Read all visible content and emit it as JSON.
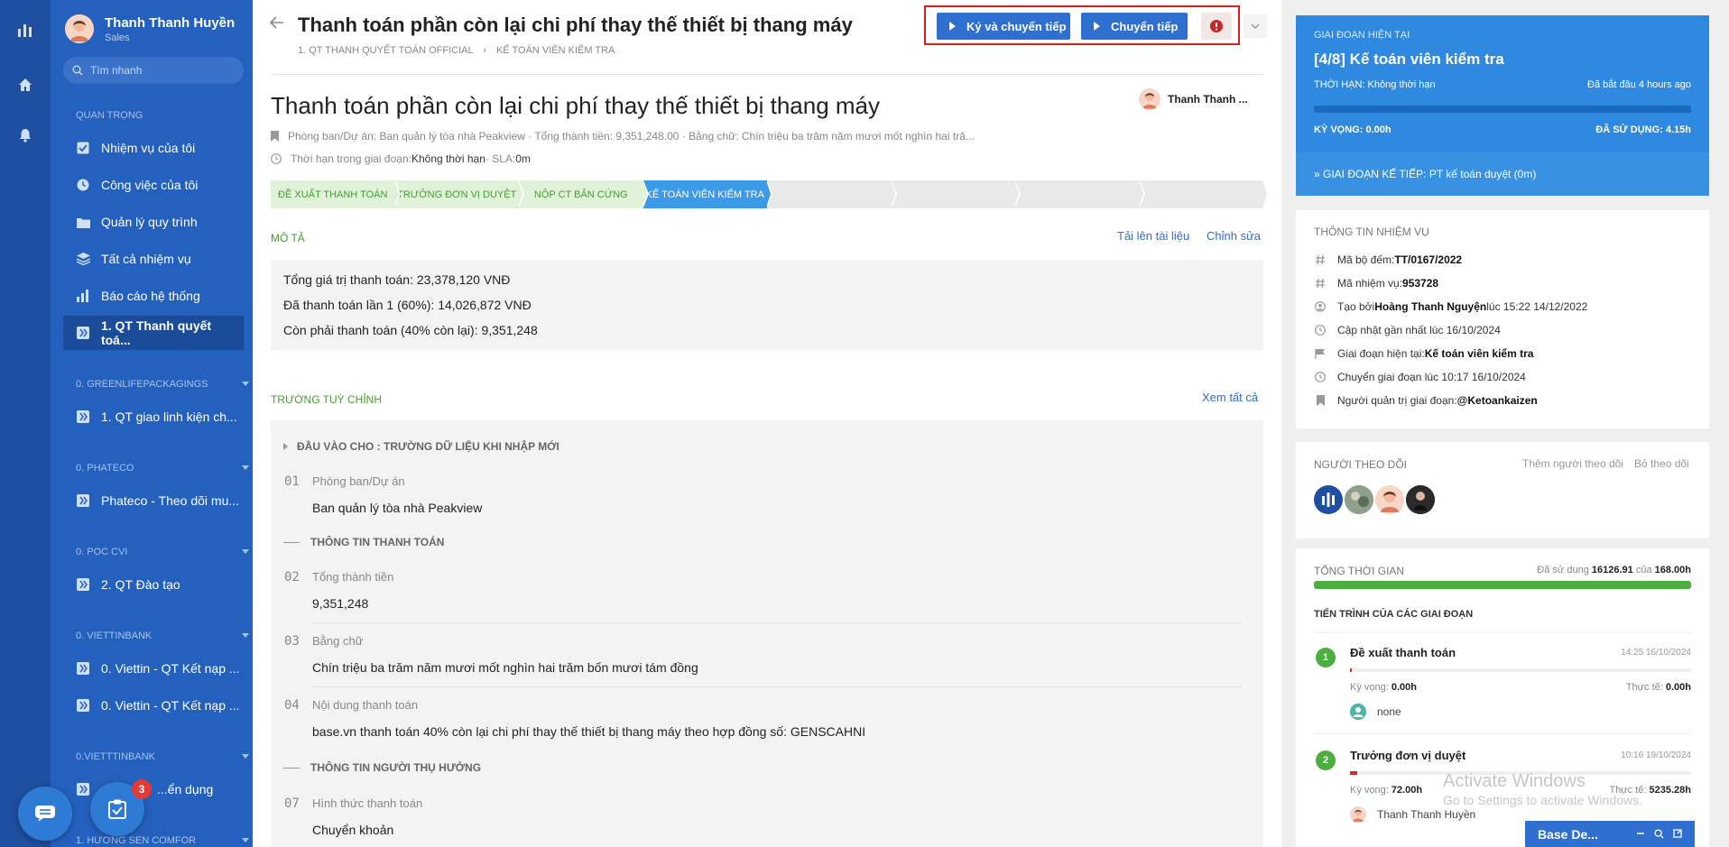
{
  "sidebar": {
    "user_name": "Thanh Thanh Huyền",
    "user_role": "Sales",
    "search_placeholder": "Tìm nhanh",
    "section_important": "QUAN TRỌNG",
    "nav": [
      "Nhiệm vụ của tôi",
      "Công việc của tôi",
      "Quản lý quy trình",
      "Tất cả nhiệm vụ",
      "Báo cáo hệ thống",
      "1. QT Thanh quyết toá..."
    ],
    "groups": [
      {
        "title": "0. GREENLIFEPACKAGINGS",
        "items": [
          "1. QT giao linh kiện ch..."
        ]
      },
      {
        "title": "0. PHATECO",
        "items": [
          "Phateco - Theo dõi mu..."
        ]
      },
      {
        "title": "0. POC CVI",
        "items": [
          "2. QT Đào tạo"
        ]
      },
      {
        "title": "0. VIETTINBANK",
        "items": [
          "0. Viettin - QT Kết nạp ...",
          "0. Viettin - QT Kết nạp ..."
        ]
      },
      {
        "title": "0.VIETTTINBANK",
        "items": [
          "...ển dụng"
        ]
      },
      {
        "title": "1. HƯƠNG SEN COMFOR",
        "items": []
      }
    ],
    "badge_count": "3"
  },
  "header": {
    "title": "Thanh toán phần còn lại chi phí thay thế thiết bị thang máy",
    "breadcrumb_1": "1. QT THANH QUYẾT TOÁN OFFICIAL",
    "breadcrumb_sep": "›",
    "breadcrumb_2": "KẾ TOÁN VIÊN KIỂM TRA",
    "btn_sign": "Ký và chuyển tiếp",
    "btn_forward": "Chuyển tiếp"
  },
  "task": {
    "title": "Thanh toán phần còn lại chi phí thay thế thiết bị thang máy",
    "assignee": "Thanh Thanh ...",
    "meta_line": "Phòng ban/Dự án: Ban quản lý tòa nhà Peakview · Tổng thành tiền: 9,351,248.00 · Bằng chữ: Chín triệu ba trăm năm mươi mốt nghìn hai tră...",
    "deadline_label": "Thời hạn trong giai đoạn: ",
    "deadline_value": "Không thời hạn",
    "sla_label": " · SLA: ",
    "sla_value": "0m",
    "stages": [
      "ĐỀ XUẤT THANH TOÁN",
      "TRƯỞNG ĐƠN VỊ DUYỆT",
      "NỘP CT BẢN CỨNG",
      "KẾ TOÁN VIÊN KIỂM TRA",
      "",
      "",
      "",
      ""
    ],
    "desc_title": "MÔ TẢ",
    "upload_link": "Tải lên tài liệu",
    "edit_link": "Chỉnh sửa",
    "desc_lines": [
      "Tổng giá trị thanh toán: 23,378,120 VNĐ",
      "Đã thanh toán lần 1 (60%): 14,026,872 VNĐ",
      "Còn phải thanh toán (40% còn lại): 9,351,248"
    ],
    "custom_title": "TRƯỜNG TUỲ CHỈNH",
    "see_all": "Xem tất cả",
    "group_input": "ĐẦU VÀO CHO : TRƯỜNG DỮ LIỆU KHI NHẬP MỚI",
    "group_payment": "THÔNG TIN THANH TOÁN",
    "group_beneficiary": "THÔNG TIN NGƯỜI THỤ HƯỞNG",
    "fields": [
      {
        "num": "01",
        "label": "Phòng ban/Dự án",
        "value": "Ban quản lý tòa nhà Peakview"
      },
      {
        "num": "02",
        "label": "Tổng thành tiền",
        "value": "9,351,248"
      },
      {
        "num": "03",
        "label": "Bằng chữ",
        "value": "Chín triệu ba trăm năm mươi mốt nghìn hai trăm bốn mươi tám đồng"
      },
      {
        "num": "04",
        "label": "Nội dung thanh toán",
        "value": "base.vn thanh toán 40% còn lại chi phí thay thế thiết bị thang máy theo hợp đồng số: GENSCAHNI"
      },
      {
        "num": "07",
        "label": "Hình thức thanh toán",
        "value": "Chuyển khoản"
      }
    ]
  },
  "right": {
    "current_label": "GIAI ĐOẠN HIỆN TẠI",
    "current_stage": "[4/8] Kế toán viên kiểm tra",
    "deadline": "THỜI HẠN: Không thời hạn",
    "started": "Đã bắt đầu 4 hours ago",
    "expect_label": "KỲ VỌNG: 0.00h",
    "used_label": "ĐÃ SỬ DỤNG: ",
    "used_value": "4.15h",
    "next_stage": "» GIAI ĐOẠN KẾ TIẾP: PT kế toán duyệt (0m)",
    "info_title": "THÔNG TIN NHIỆM VỤ",
    "info": [
      {
        "label": "Mã bộ đếm: ",
        "value": "TT/0167/2022",
        "tail": ""
      },
      {
        "label": "Mã nhiệm vụ: ",
        "value": "953728",
        "tail": ""
      },
      {
        "label": "Tạo bởi ",
        "value": "Hoàng Thanh Nguyện",
        "tail": " lúc 15:22 14/12/2022"
      },
      {
        "label": "Cập nhật gần nhất lúc 16/10/2024",
        "value": "",
        "tail": ""
      },
      {
        "label": "Giai đoạn hiện tại: ",
        "value": "Kế toán viên kiểm tra",
        "tail": ""
      },
      {
        "label": "Chuyển giai đoạn lúc 10:17 16/10/2024",
        "value": "",
        "tail": ""
      },
      {
        "label": "Người quản trị giai đoạn: ",
        "value": "@Ketoankaizen",
        "tail": ""
      }
    ],
    "followers_title": "NGƯỜI THEO DÕI",
    "add_follower": "Thêm người theo dõi",
    "unfollow": "Bỏ theo dõi",
    "total_title": "TỔNG THỜI GIAN",
    "total_used_label": "Đã sử dụng ",
    "total_used": "16126.91",
    "total_of": " của ",
    "total_limit": "168.00h",
    "progress_title": "TIẾN TRÌNH CỦA CÁC GIAI ĐOẠN",
    "steps": [
      {
        "n": "1",
        "name": "Đề xuất thanh toán",
        "date": "14:25 16/10/2024",
        "expect": "0.00h",
        "actual": "0.00h",
        "user": "none",
        "progress": 0.005
      },
      {
        "n": "2",
        "name": "Trưởng đơn vị duyệt",
        "date": "10:16 19/10/2024",
        "expect": "72.00h",
        "actual": "5235.28h",
        "user": "Thanh Thanh Huyền",
        "progress": 0.02
      }
    ],
    "expect_word": "Kỳ vọng: ",
    "actual_word": "Thực tế: "
  },
  "overlay": {
    "activate_title": "Activate Windows",
    "activate_sub": "Go to Settings to activate Windows.",
    "base_bar": "Base De..."
  },
  "colors": {
    "sidebar": "#2461be",
    "accent": "#2f6fcf",
    "stage_done": "#e0f2d9",
    "stage_current": "#3d9ae8",
    "highlight_border": "#e11c1c"
  }
}
